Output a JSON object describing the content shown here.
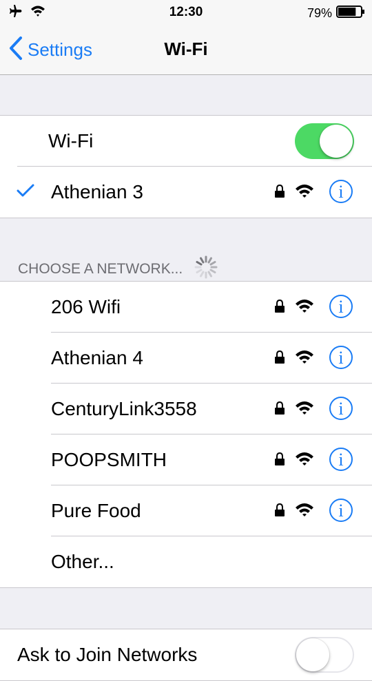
{
  "status_bar": {
    "time": "12:30",
    "battery_percent": "79%",
    "battery_level": 0.79,
    "icons": [
      "airplane-icon",
      "wifi-icon",
      "battery-icon"
    ]
  },
  "nav": {
    "back_label": "Settings",
    "title": "Wi-Fi"
  },
  "wifi_toggle": {
    "label": "Wi-Fi",
    "on": true
  },
  "connected_network": {
    "name": "Athenian 3",
    "secured": true,
    "info_glyph": "i"
  },
  "section": {
    "header": "CHOOSE A NETWORK..."
  },
  "networks": [
    {
      "name": "206 Wifi",
      "secured": true,
      "info_glyph": "i"
    },
    {
      "name": "Athenian 4",
      "secured": true,
      "info_glyph": "i"
    },
    {
      "name": "CenturyLink3558",
      "secured": true,
      "info_glyph": "i"
    },
    {
      "name": "POOPSMITH",
      "secured": true,
      "info_glyph": "i"
    },
    {
      "name": "Pure Food",
      "secured": true,
      "info_glyph": "i"
    }
  ],
  "other_label": "Other...",
  "ask_to_join": {
    "label": "Ask to Join Networks",
    "on": false
  },
  "colors": {
    "accent": "#1a7cf5",
    "toggle_on": "#4cd964",
    "background": "#efeff4"
  }
}
